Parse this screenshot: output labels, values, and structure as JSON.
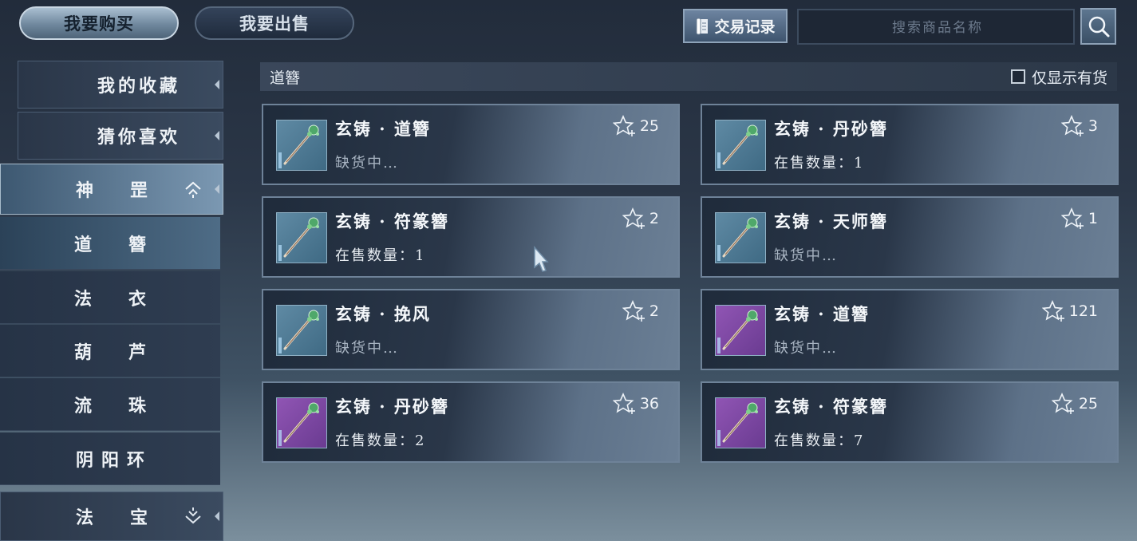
{
  "top_tabs": {
    "buy": "我要购买",
    "sell": "我要出售"
  },
  "toolbar": {
    "history_label": "交易记录",
    "search_placeholder": "搜索商品名称"
  },
  "sidebar": {
    "items": [
      {
        "label": "我的收藏"
      },
      {
        "label": "猜你喜欢"
      },
      {
        "label": "神罡"
      },
      {
        "label": "道簪"
      },
      {
        "label": "法衣"
      },
      {
        "label": "葫芦"
      },
      {
        "label": "流珠"
      },
      {
        "label": "阴阳环"
      },
      {
        "label": "法宝"
      }
    ],
    "active": "道簪",
    "expanded": "神罡"
  },
  "category": {
    "title": "道簪",
    "filter_label": "仅显示有货",
    "filter_checked": false
  },
  "items": [
    {
      "name": "玄铸 · 道簪",
      "status": "缺货中…",
      "favorites": "25",
      "rarity": "blue"
    },
    {
      "name": "玄铸 · 丹砂簪",
      "status": "在售数量：1",
      "favorites": "3",
      "rarity": "blue"
    },
    {
      "name": "玄铸 · 符篆簪",
      "status": "在售数量：1",
      "favorites": "2",
      "rarity": "blue"
    },
    {
      "name": "玄铸 · 天师簪",
      "status": "缺货中…",
      "favorites": "1",
      "rarity": "blue"
    },
    {
      "name": "玄铸 · 挽风",
      "status": "缺货中…",
      "favorites": "2",
      "rarity": "blue"
    },
    {
      "name": "玄铸 · 道簪",
      "status": "缺货中…",
      "favorites": "121",
      "rarity": "purple"
    },
    {
      "name": "玄铸 · 丹砂簪",
      "status": "在售数量：2",
      "favorites": "36",
      "rarity": "purple"
    },
    {
      "name": "玄铸 · 符篆簪",
      "status": "在售数量：7",
      "favorites": "25",
      "rarity": "purple"
    }
  ],
  "icons": {
    "history": "scroll-icon",
    "search": "magnifier-icon",
    "favorite": "star-plus-icon",
    "expand_up": "chevron-up-icon",
    "expand_down": "chevron-down-icon"
  },
  "colors": {
    "rarity_blue": "#4f7b96",
    "rarity_purple": "#7b47a3"
  }
}
